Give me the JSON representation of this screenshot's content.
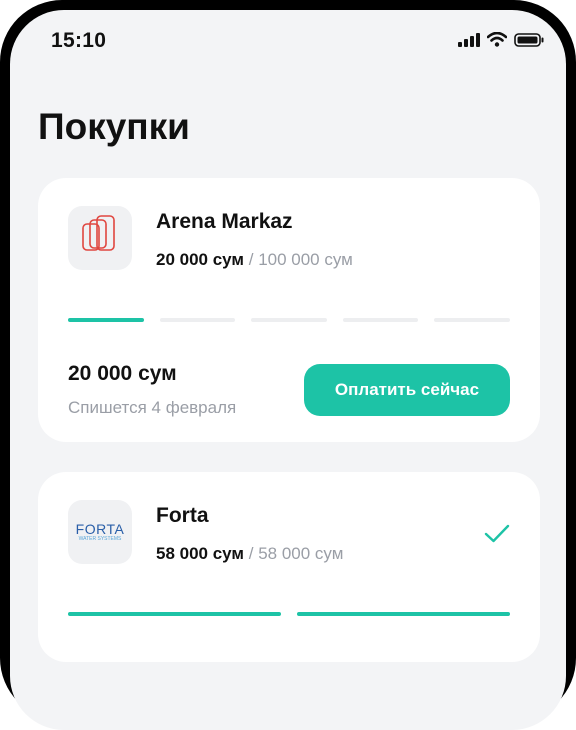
{
  "status_bar": {
    "time": "15:10",
    "icons": [
      "cellular-signal-icon",
      "wifi-icon",
      "battery-icon"
    ]
  },
  "page": {
    "title": "Покупки"
  },
  "purchases": [
    {
      "merchant": "Arena Markaz",
      "logo": "arena-markaz-logo",
      "paid": "20 000 сум",
      "separator": "/",
      "total": "100 000 сум",
      "progress": {
        "completed_payments": 1,
        "total_payments": 5
      },
      "next_payment": {
        "amount": "20 000 сум",
        "date_text": "Спишется 4 февраля"
      },
      "action_label": "Оплатить сейчас"
    },
    {
      "merchant": "Forta",
      "logo": "forta-water-systems-logo",
      "logo_text": "FORTA",
      "logo_subtext": "WATER SYSTEMS",
      "paid": "58 000 сум",
      "separator": "/",
      "total": "58 000 сум",
      "progress": {
        "completed_payments": 2,
        "total_payments": 2
      },
      "status_icon": "checkmark-icon"
    }
  ],
  "colors": {
    "accent": "#1dc3a6",
    "background": "#f3f4f6",
    "card": "#ffffff",
    "muted_text": "#9a9ea6",
    "progress_track": "#edeef0"
  }
}
